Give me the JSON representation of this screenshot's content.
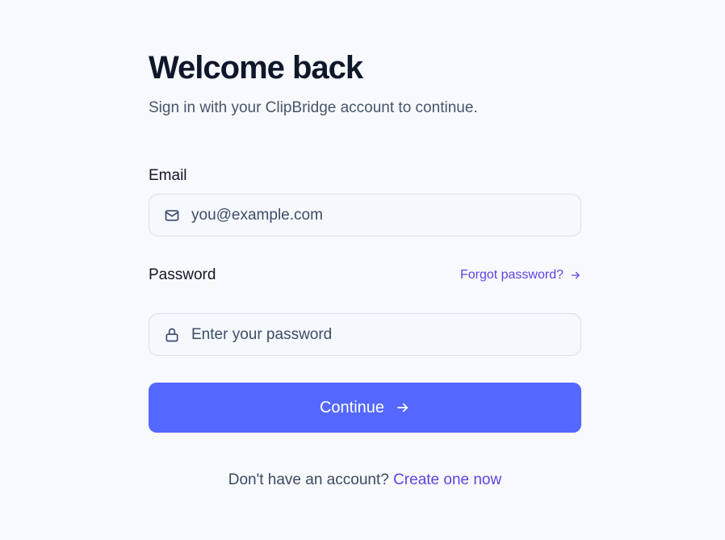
{
  "header": {
    "title": "Welcome back",
    "subtitle": "Sign in with your ClipBridge account to continue."
  },
  "email": {
    "label": "Email",
    "placeholder": "you@example.com",
    "value": "",
    "icon": "mail-icon"
  },
  "password": {
    "label": "Password",
    "placeholder": "Enter your password",
    "value": "",
    "icon": "lock-icon",
    "forgot_label": "Forgot password?",
    "forgot_icon": "arrow-right-icon"
  },
  "submit": {
    "label": "Continue",
    "icon": "arrow-right-icon"
  },
  "signup": {
    "prompt": "Don't have an account?",
    "link_label": "Create one now"
  },
  "colors": {
    "background": "#f7f9fc",
    "accent": "#5468ff",
    "link": "#5b46e0",
    "heading": "#0f172a"
  }
}
